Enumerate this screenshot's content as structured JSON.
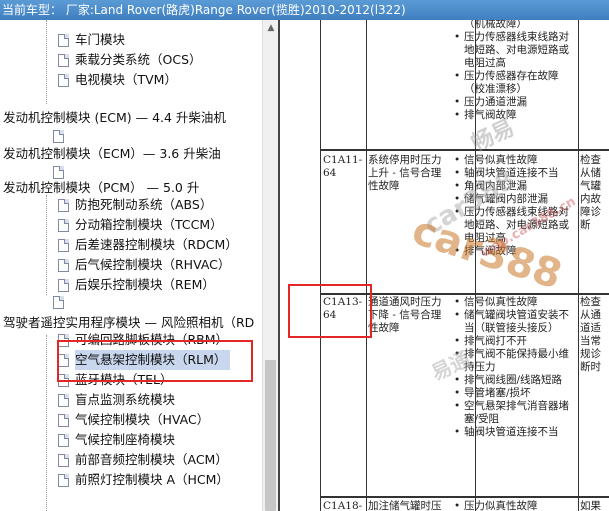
{
  "header": {
    "title": "当前车型：  厂家:Land Rover(路虎)Range Rover(揽胜)2010-2012(l322)"
  },
  "tree": {
    "items": [
      {
        "label": "车门模块",
        "icon": "document-icon"
      },
      {
        "label": "乘载分类系统（OCS）",
        "icon": "document-icon"
      },
      {
        "label": "电视模块（TVM）",
        "icon": "document-icon"
      },
      {
        "label": "发动机控制模块 (ECM) — 4.4 升柴油机"
      },
      {
        "label": "",
        "icon": "document-icon"
      },
      {
        "label": "发动机控制模块（ECM）— 3.6 升柴油"
      },
      {
        "label": "",
        "icon": "document-icon"
      },
      {
        "label": "发动机控制模块（PCM） — 5.0 升"
      },
      {
        "label": "防抱死制动系统（ABS）",
        "icon": "document-icon"
      },
      {
        "label": "分动箱控制模块（TCCM）",
        "icon": "document-icon"
      },
      {
        "label": "后差速器控制模块（RDCM）",
        "icon": "document-icon"
      },
      {
        "label": "后气候控制模块（RHVAC）",
        "icon": "document-icon"
      },
      {
        "label": "后娱乐控制模块（REM）",
        "icon": "document-icon"
      },
      {
        "label": "",
        "icon": "document-icon"
      },
      {
        "label": "驾驶者遥控实用程序模块 — 风险照相机（RD"
      },
      {
        "label": "可编回路脚板模块（RBM）",
        "icon": "document-icon"
      },
      {
        "label": "空气悬架控制模块（RLM）",
        "icon": "document-icon",
        "selected": true
      },
      {
        "label": "蓝牙模块（TEL）",
        "icon": "document-icon"
      },
      {
        "label": "盲点监测系统模块",
        "icon": "document-icon"
      },
      {
        "label": "气候控制模块（HVAC）",
        "icon": "document-icon"
      },
      {
        "label": "气候控制座椅模块",
        "icon": "document-icon"
      },
      {
        "label": "前部音频控制模块（ACM）",
        "icon": "document-icon"
      },
      {
        "label": "前照灯控制模块 A（HCM）",
        "icon": "document-icon"
      }
    ]
  },
  "table": {
    "row0": {
      "causes": [
        "（机械故障）",
        "压力传感器线束线路对地短路、对电源短路或电阻过高",
        "压力传感器存在故障（校准漂移）",
        "压力通道泄漏",
        "排气阀故障"
      ]
    },
    "row1": {
      "code": "C1A11-64",
      "description": "系统停用时压力上升 - 信号合理性故障",
      "causes": [
        "信号似真性故障",
        "轴阀块管道连接不当",
        "角阀内部泄漏",
        "储气罐阀内部泄漏",
        "压力传感器线束线路对地短路、对电源短路或电阻过高",
        "排气阀故障"
      ],
      "action": "检查从储气罐内故障诊断"
    },
    "row2": {
      "code": "C1A13-64",
      "description": "通道通风时压力下降 - 信号合理性故障",
      "causes": [
        "信号似真性故障",
        "储气罐阀块管道安装不当（联管接头接反）",
        "排气阀打不开",
        "排气阀不能保持最小维持压力",
        "排气阀线圈/线路短路",
        "导管堵塞/损坏",
        "空气悬架排气消音器堵塞/受阻",
        "轴阀块管道连接不当"
      ],
      "action": "检查从通道适当常规诊断时"
    },
    "row3": {
      "code": "C1A18-",
      "description": "加注储气罐时压",
      "causes": [
        "压力似真性故障"
      ],
      "action": "如果有"
    }
  },
  "watermarks": [
    "畅易",
    "car388",
    "易通",
    "wap.car388.cn"
  ]
}
